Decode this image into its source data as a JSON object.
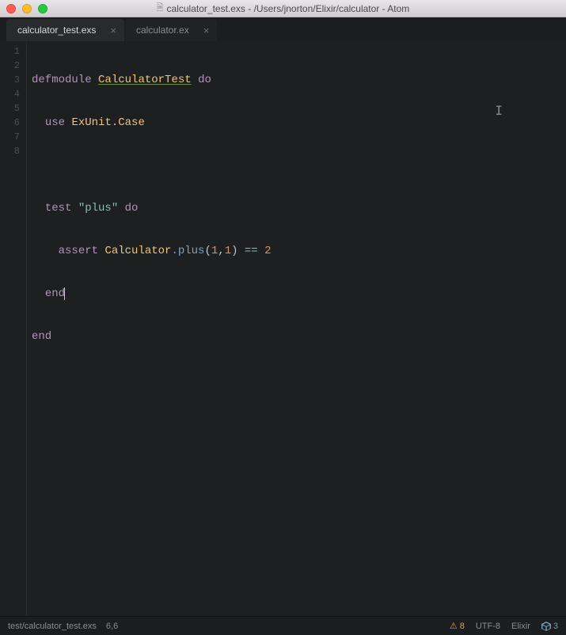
{
  "window": {
    "title": "calculator_test.exs - /Users/jnorton/Elixir/calculator - Atom"
  },
  "tabs": [
    {
      "label": "calculator_test.exs",
      "active": true
    },
    {
      "label": "calculator.ex",
      "active": false
    }
  ],
  "gutter": {
    "lines": [
      "1",
      "2",
      "3",
      "4",
      "5",
      "6",
      "7",
      "8"
    ]
  },
  "code": {
    "l1_def": "defmodule",
    "l1_mod": "CalculatorTest",
    "l1_do": "do",
    "l2_use": "use",
    "l2_mod": "ExUnit.Case",
    "l4_test": "test",
    "l4_str": "\"plus\"",
    "l4_do": "do",
    "l5_assert": "assert",
    "l5_mod": "Calculator",
    "l5_fn": ".plus",
    "l5_open": "(",
    "l5_n1": "1",
    "l5_c": ",",
    "l5_n2": "1",
    "l5_close": ")",
    "l5_op": "==",
    "l5_res": "2",
    "l6_end": "end",
    "l7_end": "end"
  },
  "status": {
    "path": "test/calculator_test.exs",
    "pos": "6,6",
    "warn_count": "8",
    "encoding": "UTF-8",
    "language": "Elixir",
    "pkg_count": "3"
  }
}
